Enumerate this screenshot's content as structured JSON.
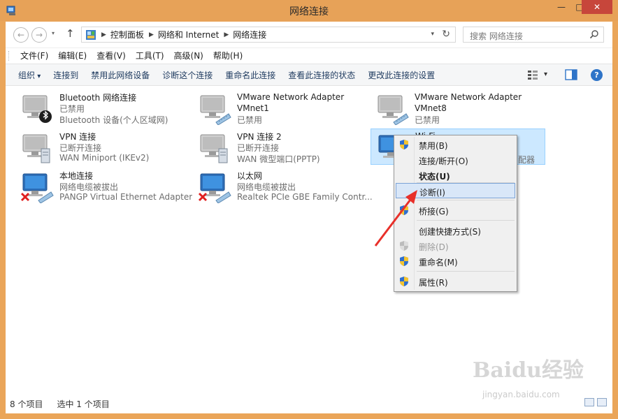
{
  "window": {
    "title": "网络连接",
    "min": "—",
    "max": "□",
    "close": "✕"
  },
  "nav": {
    "back": "←",
    "forward": "→",
    "recent": "▾",
    "up": "↑"
  },
  "address": {
    "breadcrumbs": [
      "控制面板",
      "网络和 Internet",
      "网络连接"
    ],
    "separator": "▶",
    "dropdown": "▾",
    "refresh": "↻"
  },
  "search": {
    "placeholder": "搜索 网络连接"
  },
  "menu": [
    "文件(F)",
    "编辑(E)",
    "查看(V)",
    "工具(T)",
    "高级(N)",
    "帮助(H)"
  ],
  "commands": [
    "组织",
    "连接到",
    "禁用此网络设备",
    "诊断这个连接",
    "重命名此连接",
    "查看此连接的状态",
    "更改此连接的设置"
  ],
  "help_glyph": "?",
  "view_drop": "▾",
  "connections": [
    {
      "name": "Bluetooth 网络连接",
      "status": "已禁用",
      "device": "Bluetooth 设备(个人区域网)",
      "icon": "bluetooth-network-icon",
      "badge": "bluetooth"
    },
    {
      "name": "VMware Network Adapter VMnet1",
      "status": "已禁用",
      "device": "",
      "icon": "ethernet-adapter-icon",
      "badge": "cable"
    },
    {
      "name": "VMware Network Adapter VMnet8",
      "status": "已禁用",
      "device": "",
      "icon": "ethernet-adapter-icon",
      "badge": "cable"
    },
    {
      "name": "VPN 连接",
      "status": "已断开连接",
      "device": "WAN Miniport (IKEv2)",
      "icon": "vpn-icon",
      "badge": "server"
    },
    {
      "name": "VPN 连接 2",
      "status": "已断开连接",
      "device": "WAN 微型端口(PPTP)",
      "icon": "vpn-icon",
      "badge": "server"
    },
    {
      "name": "Wi-Fi",
      "status": "",
      "device": "配器",
      "icon": "wifi-adapter-icon",
      "badge": "signal"
    },
    {
      "name": "本地连接",
      "status": "网络电缆被拔出",
      "device": "PANGP Virtual Ethernet Adapter",
      "icon": "ethernet-adapter-icon",
      "badge": "error"
    },
    {
      "name": "以太网",
      "status": "网络电缆被拔出",
      "device": "Realtek PCIe GBE Family Contr...",
      "icon": "ethernet-adapter-icon",
      "badge": "error"
    }
  ],
  "context_menu": [
    {
      "label": "禁用(B)",
      "shield": true,
      "style": "normal"
    },
    {
      "label": "连接/断开(O)",
      "shield": false,
      "style": "normal"
    },
    {
      "label": "状态(U)",
      "shield": false,
      "style": "bold"
    },
    {
      "label": "诊断(I)",
      "shield": false,
      "style": "hover"
    },
    {
      "label": "桥接(G)",
      "shield": true,
      "style": "normal"
    },
    {
      "label": "创建快捷方式(S)",
      "shield": false,
      "style": "normal"
    },
    {
      "label": "删除(D)",
      "shield": true,
      "style": "disabled"
    },
    {
      "label": "重命名(M)",
      "shield": true,
      "style": "normal"
    },
    {
      "label": "属性(R)",
      "shield": true,
      "style": "normal"
    }
  ],
  "statusbar": {
    "count": "8 个项目",
    "selected": "选中 1 个项目"
  },
  "watermark": {
    "brand": "Baidu经验",
    "url": "jingyan.baidu.com"
  },
  "colors": {
    "titlebar": "#e7a258",
    "selection": "#cce8ff",
    "menu_hover": "#d9e7f8",
    "annotation_arrow": "#e8302a",
    "shield_blue": "#2e6fd0",
    "shield_yellow": "#f4c430"
  }
}
